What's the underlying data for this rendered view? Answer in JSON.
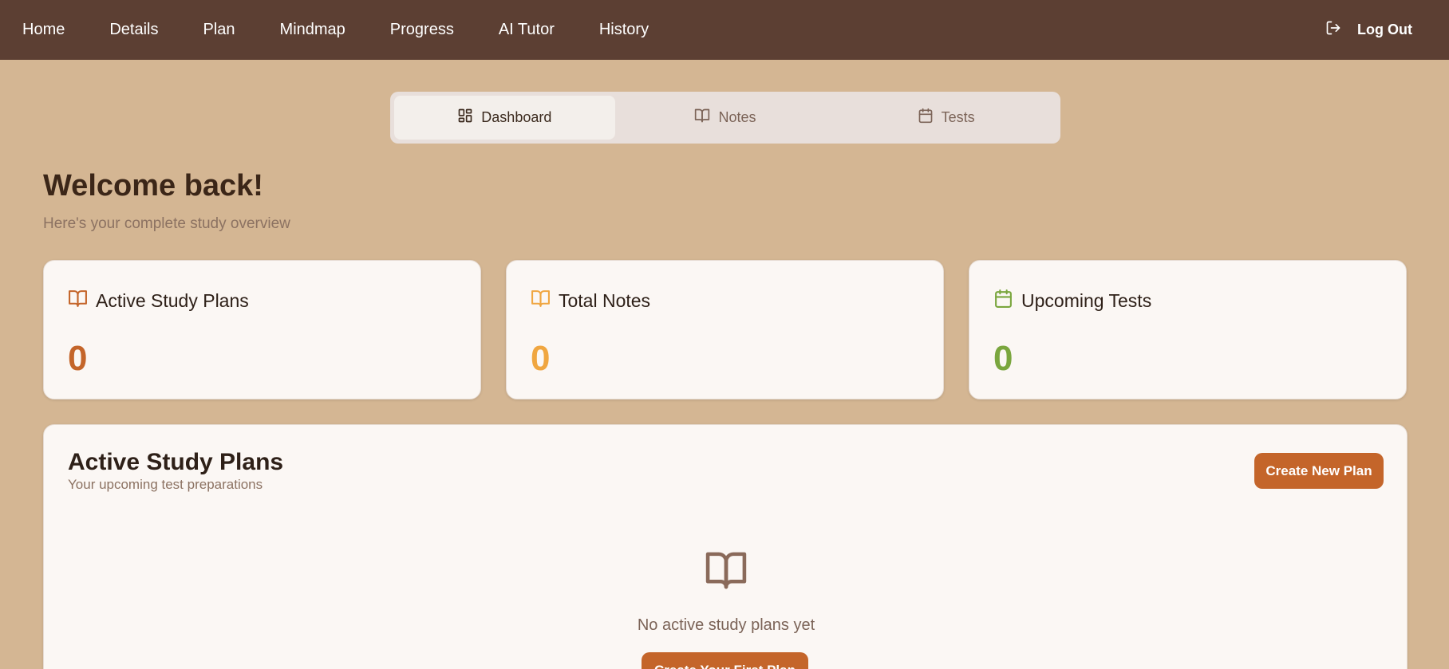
{
  "nav": {
    "items": [
      {
        "label": "Home"
      },
      {
        "label": "Details"
      },
      {
        "label": "Plan"
      },
      {
        "label": "Mindmap"
      },
      {
        "label": "Progress"
      },
      {
        "label": "AI Tutor"
      },
      {
        "label": "History"
      }
    ],
    "logout_label": "Log Out",
    "logout_icon": "log-out-icon"
  },
  "tabs": [
    {
      "label": "Dashboard",
      "icon": "dashboard-icon",
      "active": true
    },
    {
      "label": "Notes",
      "icon": "book-open-icon",
      "active": false
    },
    {
      "label": "Tests",
      "icon": "calendar-icon",
      "active": false
    }
  ],
  "welcome": {
    "title": "Welcome back!",
    "subtitle": "Here's your complete study overview"
  },
  "stats": [
    {
      "label": "Active Study Plans",
      "value": "0",
      "icon": "book-open-icon",
      "color": "#c4652a"
    },
    {
      "label": "Total Notes",
      "value": "0",
      "icon": "book-open-icon",
      "color": "#f0a640"
    },
    {
      "label": "Upcoming Tests",
      "value": "0",
      "icon": "calendar-icon",
      "color": "#7aa63e"
    }
  ],
  "plans": {
    "title": "Active Study Plans",
    "subtitle": "Your upcoming test preparations",
    "create_label": "Create New Plan",
    "empty_text": "No active study plans yet",
    "first_plan_label": "Create Your First Plan",
    "empty_icon": "book-open-icon"
  },
  "colors": {
    "nav_bg": "#5c3f33",
    "page_bg": "#d4b693",
    "accent": "#c4652a"
  }
}
